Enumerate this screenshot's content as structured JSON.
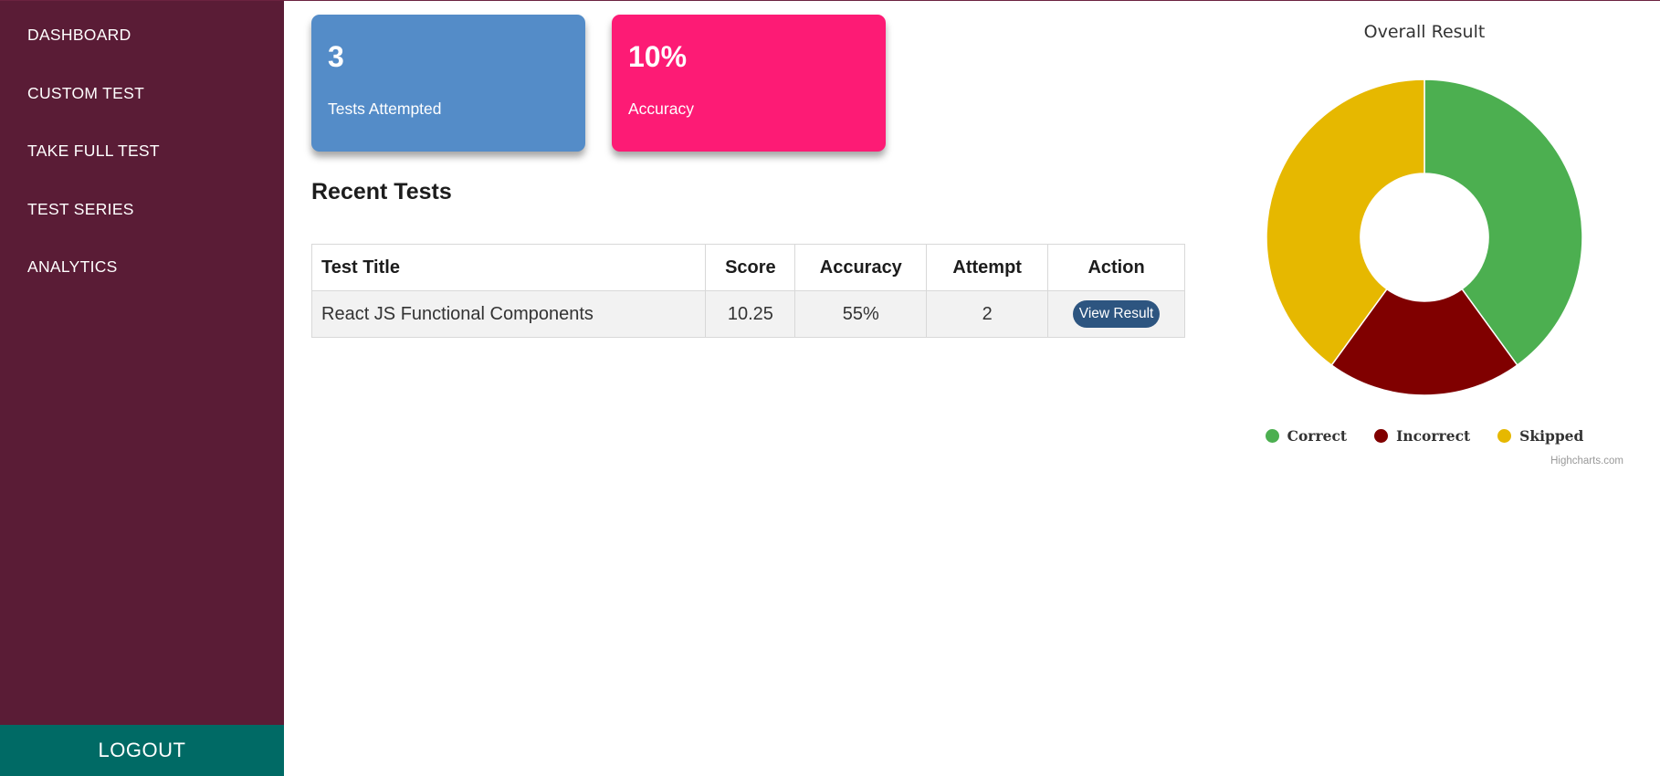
{
  "sidebar": {
    "items": [
      {
        "label": "DASHBOARD"
      },
      {
        "label": "CUSTOM TEST"
      },
      {
        "label": "TAKE FULL TEST"
      },
      {
        "label": "TEST SERIES"
      },
      {
        "label": "ANALYTICS"
      }
    ],
    "logout_label": "LOGOUT",
    "background": "#5a1c36",
    "logout_background": "#006a65"
  },
  "stats": {
    "tests_attempted": {
      "value": "3",
      "label": "Tests Attempted",
      "color": "#548cc8"
    },
    "accuracy": {
      "value": "10%",
      "label": "Accuracy",
      "color": "#fd1b75"
    }
  },
  "recent_tests": {
    "title": "Recent Tests",
    "columns": [
      "Test Title",
      "Score",
      "Accuracy",
      "Attempt",
      "Action"
    ],
    "rows": [
      {
        "title": "React JS Functional Components",
        "score": "10.25",
        "accuracy": "55%",
        "attempt": "2",
        "action_label": "View Result"
      }
    ]
  },
  "chart_data": {
    "type": "pie",
    "title": "Overall Result",
    "donut": true,
    "categories": [
      "Correct",
      "Incorrect",
      "Skipped"
    ],
    "values": [
      40,
      20,
      40
    ],
    "colors": [
      "#4caf50",
      "#800000",
      "#e6b800"
    ],
    "legend": "bottom",
    "credits": "Highcharts.com"
  }
}
